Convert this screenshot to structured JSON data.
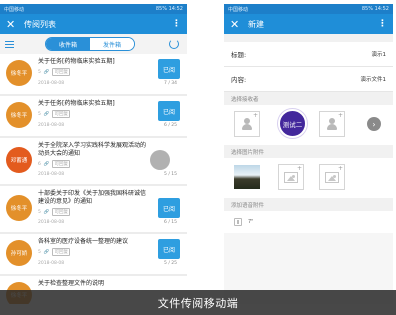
{
  "left": {
    "status": {
      "left": "中国移动",
      "right": "85% 14:52"
    },
    "title": "传阅列表",
    "tabs": [
      {
        "label": "收件箱",
        "active": true
      },
      {
        "label": "发件箱",
        "active": false
      }
    ],
    "items": [
      {
        "sender": "徐冬平",
        "color": "#e3902a",
        "title": "关于任务[药物临床实验五期]",
        "count": "5",
        "status": "可回复",
        "date": "2018-08-08",
        "views": "7 / 34",
        "button": "已阅"
      },
      {
        "sender": "徐冬平",
        "color": "#e3902a",
        "title": "关于任务[药物临床实验五期]",
        "count": "5",
        "status": "可回复",
        "date": "2018-08-08",
        "views": "6 / 25",
        "button": "已阅"
      },
      {
        "sender": "邓蓄通",
        "color": "#e35b1e",
        "title": "关于全院深入学习实践科学发展观活动的动员大会的通知",
        "count": "6",
        "status": "可回复",
        "date": "2018-08-08",
        "views": "5 / 15",
        "button": ""
      },
      {
        "sender": "徐冬平",
        "color": "#e3902a",
        "title": "十部委关于印发《关于加强我国科研诚信建设的意见》的通知",
        "count": "5",
        "status": "可回复",
        "date": "2018-08-08",
        "views": "6 / 15",
        "button": "已阅"
      },
      {
        "sender": "孙可娇",
        "color": "#e3902a",
        "title": "各科室的医疗设备统一整理的建议",
        "count": "5",
        "status": "可回复",
        "date": "2018-08-08",
        "views": "5 / 25",
        "button": "已阅"
      },
      {
        "sender": "徐冬平",
        "color": "#e3902a",
        "title": "关于检查整理文件的说明",
        "count": "",
        "status": "",
        "date": "",
        "views": "",
        "button": ""
      }
    ]
  },
  "right": {
    "status": {
      "left": "中国移动",
      "right": "85% 14:52"
    },
    "title": "新建",
    "fields": [
      {
        "label": "标题:",
        "value": "演示1"
      },
      {
        "label": "内容:",
        "value": "演示文件1"
      }
    ],
    "sections": {
      "recipients": "选择接收者",
      "images": "选择图片附件",
      "audio": "添加语音附件"
    },
    "recipient_name": "测试二",
    "audio_value": "7\""
  },
  "caption": "文件传阅移动端"
}
